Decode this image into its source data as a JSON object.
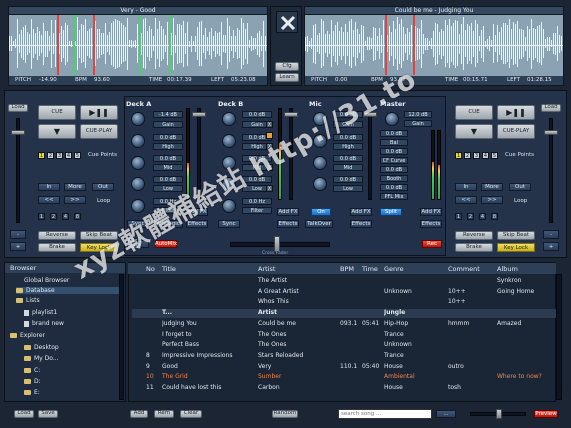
{
  "deck_a_track": {
    "title": "Very - Good",
    "pitch_label": "PITCH",
    "pitch": "-14.90",
    "bpm_label": "BPM",
    "bpm": "93.60",
    "time_label": "TIME",
    "time": "00:17.39",
    "left_label": "LEFT",
    "left": "05:23.08"
  },
  "deck_b_track": {
    "title": "Could be me - Judging You",
    "pitch_label": "PITCH",
    "pitch": "0.00",
    "bpm_label": "BPM",
    "bpm": "93.07",
    "time_label": "TIME",
    "time": "00:15.71",
    "left_label": "LEFT",
    "left": "01:28.15"
  },
  "center": {
    "cfg": "Cfg",
    "learn": "Learn"
  },
  "left_controls": {
    "load": "Load",
    "cue": "CUE",
    "cue_play": "CUE-PLAY",
    "cue_points": "Cue Points",
    "cue_nums": [
      "1",
      "2",
      "3",
      "4",
      "5"
    ],
    "in": "In",
    "more": "More",
    "out": "Out",
    "loop": "Loop",
    "back": "<<",
    "fwd": ">>",
    "loop_nums": [
      "1",
      "2",
      "4",
      "8"
    ],
    "reverse": "Reverse",
    "skip_beat": "Skip Beat",
    "brake": "Brake",
    "key_lock": "Key Lock",
    "minus": "-",
    "plus": "+"
  },
  "right_controls": {
    "load": "Load",
    "cue": "CUE",
    "cue_play": "CUE-PLAY",
    "cue_points": "Cue Points",
    "cue_nums": [
      "1",
      "2",
      "3",
      "4",
      "5"
    ],
    "in": "In",
    "more": "More",
    "out": "Out",
    "loop": "Loop",
    "back": "<<",
    "fwd": ">>",
    "loop_nums": [
      "1",
      "2",
      "4",
      "8"
    ],
    "reverse": "Reverse",
    "skip_beat": "Skip Beat",
    "brake": "Brake",
    "key_lock": "Key Lock",
    "minus": "-",
    "plus": "+"
  },
  "mixer": {
    "deck_a": {
      "header": "Deck A",
      "gain_val": "-1.4 dB",
      "gain": "Gain",
      "high_val": "0.0 dB",
      "high": "High",
      "mid_val": "0.0 dB",
      "mid": "Mid",
      "low_val": "0.0 dB",
      "low": "Low",
      "filter_val": "0.0 Hz",
      "filter": "Filter",
      "sync": "Sync",
      "analogic": "Analogic",
      "add_fx": "Add FX",
      "effects": "Effects",
      "x": "X"
    },
    "deck_b": {
      "header": "Deck B",
      "gain_val": "0.0 dB",
      "gain": "Gain",
      "high_val": "0.0 dB",
      "high": "High",
      "mid_val": "0.0 dB",
      "mid": "Mid",
      "low_val": "0.0 dB",
      "low": "Low",
      "filter_val": "0.0 Hz",
      "filter": "Filter",
      "sync": "Sync",
      "add_fx": "Add FX",
      "effects": "Effects",
      "x": "X"
    },
    "mic": {
      "header": "Mic",
      "gain_val": "0.0 dB",
      "gain": "Gain",
      "high_val": "0.0 dB",
      "high": "High",
      "mid_val": "0.0 dB",
      "mid": "Mid",
      "low_val": "0.0 dB",
      "low": "Low",
      "add_fx": "Add FX",
      "effects": "Effects",
      "talkover": "TalkOver",
      "on": "On"
    },
    "master": {
      "header": "Master",
      "gain_val": "12.0 dB",
      "gain": "Gain",
      "bal_val": "0.0 dB",
      "bal": "Bal",
      "cf_val": "0.0 dB",
      "cf": "CF Curve",
      "booth_val": "0.0 dB",
      "booth": "Booth",
      "pfl_val": "0.0 dB",
      "pfl": "PFL Mix",
      "add_fx": "Add FX",
      "effects": "Effects",
      "split": "Split",
      "rec": "Rec"
    },
    "bottom": {
      "mix_next": "Mix Next",
      "automix": "AutoMix",
      "crossfader": "Cross Fader"
    }
  },
  "browser": {
    "header": "Browser",
    "tree": [
      "Global Browser",
      "Database",
      "Lists",
      "playlist1",
      "brand new",
      "Explorer",
      "Desktop",
      "My Do...",
      "C:",
      "D:",
      "E:"
    ]
  },
  "tracklist": {
    "columns": [
      "No",
      "Title",
      "Artist",
      "BPM",
      "Time",
      "Genre",
      "Comment",
      "Album"
    ],
    "rows": [
      {
        "no": "",
        "title": "",
        "artist": "The Artist",
        "bpm": "",
        "time": "",
        "genre": "",
        "comment": "",
        "album": "Synkron"
      },
      {
        "no": "",
        "title": "",
        "artist": "A Great Artist",
        "bpm": "",
        "time": "",
        "genre": "Unknown",
        "comment": "10++",
        "album": "Going Home"
      },
      {
        "no": "",
        "title": "",
        "artist": "Whos This",
        "bpm": "",
        "time": "",
        "genre": "",
        "comment": "10++",
        "album": ""
      },
      {
        "no": "",
        "title": "T...",
        "artist": "Artist",
        "bpm": "",
        "time": "",
        "genre": "Jungle",
        "comment": "",
        "album": ""
      },
      {
        "no": "",
        "title": "Judging You",
        "artist": "Could be me",
        "bpm": "093.1",
        "time": "05:41",
        "genre": "Hip-Hop",
        "comment": "hmmm",
        "album": "Amazed"
      },
      {
        "no": "",
        "title": "I forget to",
        "artist": "The Ones",
        "bpm": "",
        "time": "",
        "genre": "Trance",
        "comment": "",
        "album": ""
      },
      {
        "no": "",
        "title": "Perfect Bass",
        "artist": "The Ones",
        "bpm": "",
        "time": "",
        "genre": "Unknown",
        "comment": "",
        "album": ""
      },
      {
        "no": "8",
        "title": "Impressive Impressions",
        "artist": "Stars Reloaded",
        "bpm": "",
        "time": "",
        "genre": "Trance",
        "comment": "",
        "album": ""
      },
      {
        "no": "9",
        "title": "Good",
        "artist": "Very",
        "bpm": "110.1",
        "time": "05:40",
        "genre": "House",
        "comment": "outro",
        "album": ""
      },
      {
        "no": "10",
        "title": "The Grid",
        "artist": "Sumber",
        "bpm": "",
        "time": "",
        "genre": "Ambiental",
        "comment": "",
        "album": "Where to now?"
      },
      {
        "no": "11",
        "title": "Could have lost this",
        "artist": "Carbon",
        "bpm": "",
        "time": "",
        "genre": "House",
        "comment": "tosh",
        "album": ""
      }
    ]
  },
  "footer": {
    "load": "Load",
    "save": "Save",
    "add": "Add",
    "rem": "Rem",
    "clear": "Clear",
    "random": "Random",
    "search_placeholder": "search song ...",
    "preview": "Preview",
    "dots": "..."
  },
  "watermark": "xyz軟體補給站 http://31.to",
  "colors": {
    "accent_blue": "#2a7fd4",
    "marker_red": "#e6413a",
    "marker_green": "#4bd06a",
    "bg": "#1b2533"
  }
}
